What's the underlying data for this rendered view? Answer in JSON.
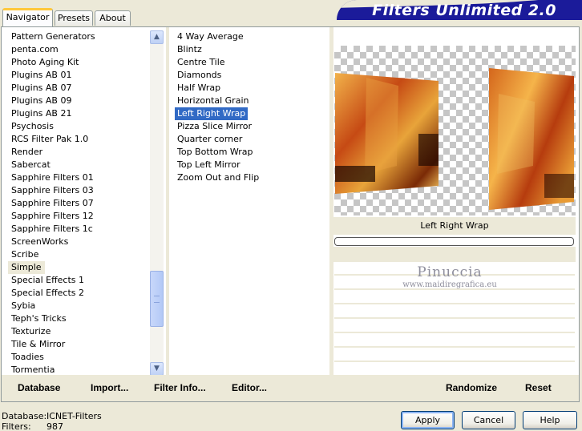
{
  "tabs": [
    {
      "label": "Navigator",
      "active": true
    },
    {
      "label": "Presets",
      "active": false
    },
    {
      "label": "About",
      "active": false
    }
  ],
  "title": "Filters Unlimited 2.0",
  "categories": [
    "Pattern Generators",
    "penta.com",
    "Photo Aging Kit",
    "Plugins AB 01",
    "Plugins AB 07",
    "Plugins AB 09",
    "Plugins AB 21",
    "Psychosis",
    "RCS Filter Pak 1.0",
    "Render",
    "Sabercat",
    "Sapphire Filters 01",
    "Sapphire Filters 03",
    "Sapphire Filters 07",
    "Sapphire Filters 12",
    "Sapphire Filters 1c",
    "ScreenWorks",
    "Scribe",
    "Simple",
    "Special Effects 1",
    "Special Effects 2",
    "Sybia",
    "Teph's Tricks",
    "Texturize",
    "Tile & Mirror",
    "Toadies",
    "Tormentia"
  ],
  "selected_category": "Simple",
  "filters": [
    "4 Way Average",
    "Blintz",
    "Centre Tile",
    "Diamonds",
    "Half Wrap",
    "Horizontal Grain",
    "Left Right Wrap",
    "Pizza Slice Mirror",
    "Quarter corner",
    "Top Bottom Wrap",
    "Top Left Mirror",
    "Zoom Out and Flip"
  ],
  "selected_filter": "Left Right Wrap",
  "preview": {
    "filter_name": "Left Right Wrap",
    "watermark_name": "Pinuccia",
    "watermark_site": "www.maidiregrafica.eu"
  },
  "bottom_buttons": {
    "database": "Database",
    "import": "Import...",
    "filter_info": "Filter Info...",
    "editor": "Editor...",
    "randomize": "Randomize",
    "reset": "Reset"
  },
  "footer": {
    "database_label": "Database:",
    "database_value": "ICNET-Filters",
    "filters_label": "Filters:",
    "filters_value": "987",
    "apply": "Apply",
    "cancel": "Cancel",
    "help": "Help"
  },
  "colors": {
    "window_bg": "#ece9d8",
    "selection": "#316ac5",
    "banner": "#1b1b9a"
  }
}
